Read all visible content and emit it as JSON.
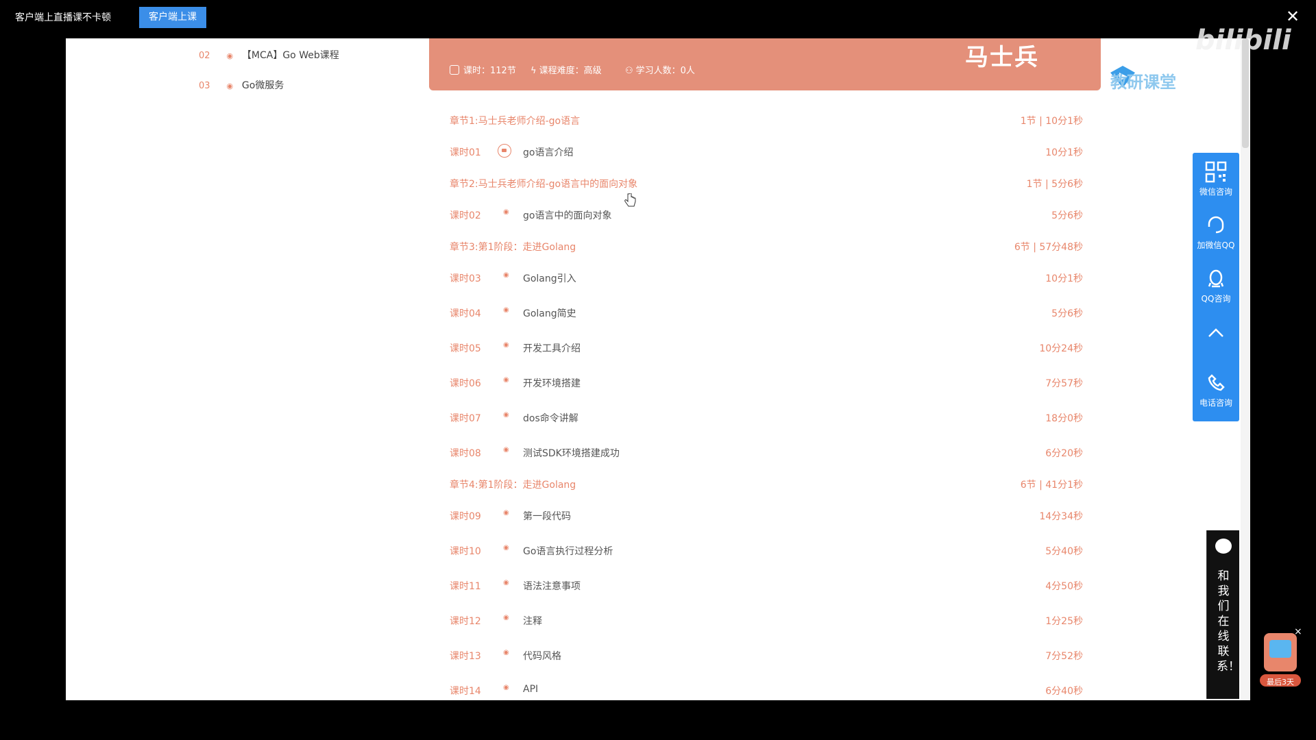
{
  "topbar": {
    "message": "客户端上直播课不卡顿",
    "client_button": "客户端上课",
    "close_icon": "close-icon"
  },
  "sidebar": {
    "items": [
      {
        "num": "02",
        "label": "【MCA】Go Web课程"
      },
      {
        "num": "03",
        "label": "Go微服务"
      }
    ]
  },
  "course_header": {
    "hours": "课时：112节",
    "difficulty": "课程难度：高级",
    "students": "学习人数：0人"
  },
  "watermark": {
    "text": "马士兵",
    "brand": "bilibili",
    "sub": "教研课堂"
  },
  "lessons": [
    {
      "type": "chapter",
      "title": "章节1:马士兵老师介绍-go语言",
      "dur": "1节 | 10分1秒"
    },
    {
      "type": "lesson",
      "num": "课时01",
      "title": "go语言介绍",
      "dur": "10分1秒",
      "locked": true
    },
    {
      "type": "chapter",
      "title": "章节2:马士兵老师介绍-go语言中的面向对象",
      "dur": "1节 | 5分6秒"
    },
    {
      "type": "lesson",
      "num": "课时02",
      "title": "go语言中的面向对象",
      "dur": "5分6秒"
    },
    {
      "type": "chapter",
      "title": "章节3:第1阶段：走进Golang",
      "dur": "6节 | 57分48秒"
    },
    {
      "type": "lesson",
      "num": "课时03",
      "title": "Golang引入",
      "dur": "10分1秒"
    },
    {
      "type": "lesson",
      "num": "课时04",
      "title": "Golang简史",
      "dur": "5分6秒"
    },
    {
      "type": "lesson",
      "num": "课时05",
      "title": "开发工具介绍",
      "dur": "10分24秒"
    },
    {
      "type": "lesson",
      "num": "课时06",
      "title": "开发环境搭建",
      "dur": "7分57秒"
    },
    {
      "type": "lesson",
      "num": "课时07",
      "title": "dos命令讲解",
      "dur": "18分0秒"
    },
    {
      "type": "lesson",
      "num": "课时08",
      "title": "测试SDK环境搭建成功",
      "dur": "6分20秒"
    },
    {
      "type": "chapter",
      "title": "章节4:第1阶段：走进Golang",
      "dur": "6节 | 41分1秒"
    },
    {
      "type": "lesson",
      "num": "课时09",
      "title": "第一段代码",
      "dur": "14分34秒"
    },
    {
      "type": "lesson",
      "num": "课时10",
      "title": "Go语言执行过程分析",
      "dur": "5分40秒"
    },
    {
      "type": "lesson",
      "num": "课时11",
      "title": "语法注意事项",
      "dur": "4分50秒"
    },
    {
      "type": "lesson",
      "num": "课时12",
      "title": "注释",
      "dur": "1分25秒"
    },
    {
      "type": "lesson",
      "num": "课时13",
      "title": "代码风格",
      "dur": "7分52秒"
    },
    {
      "type": "lesson",
      "num": "课时14",
      "title": "API",
      "dur": "6分40秒"
    }
  ],
  "float_toolbar": {
    "wechat": "微信咨询",
    "qq_wechat": "加微信QQ",
    "qq": "QQ咨询",
    "phone": "电话咨询"
  },
  "chat_tab": {
    "text": "和我们在线联系！"
  },
  "promo": {
    "label": "最后3天"
  },
  "colors": {
    "accent": "#e8866b",
    "header_bg": "#e4907a",
    "toolbar_bg": "#2d8ef0",
    "button_bg": "#3b8ee8"
  }
}
